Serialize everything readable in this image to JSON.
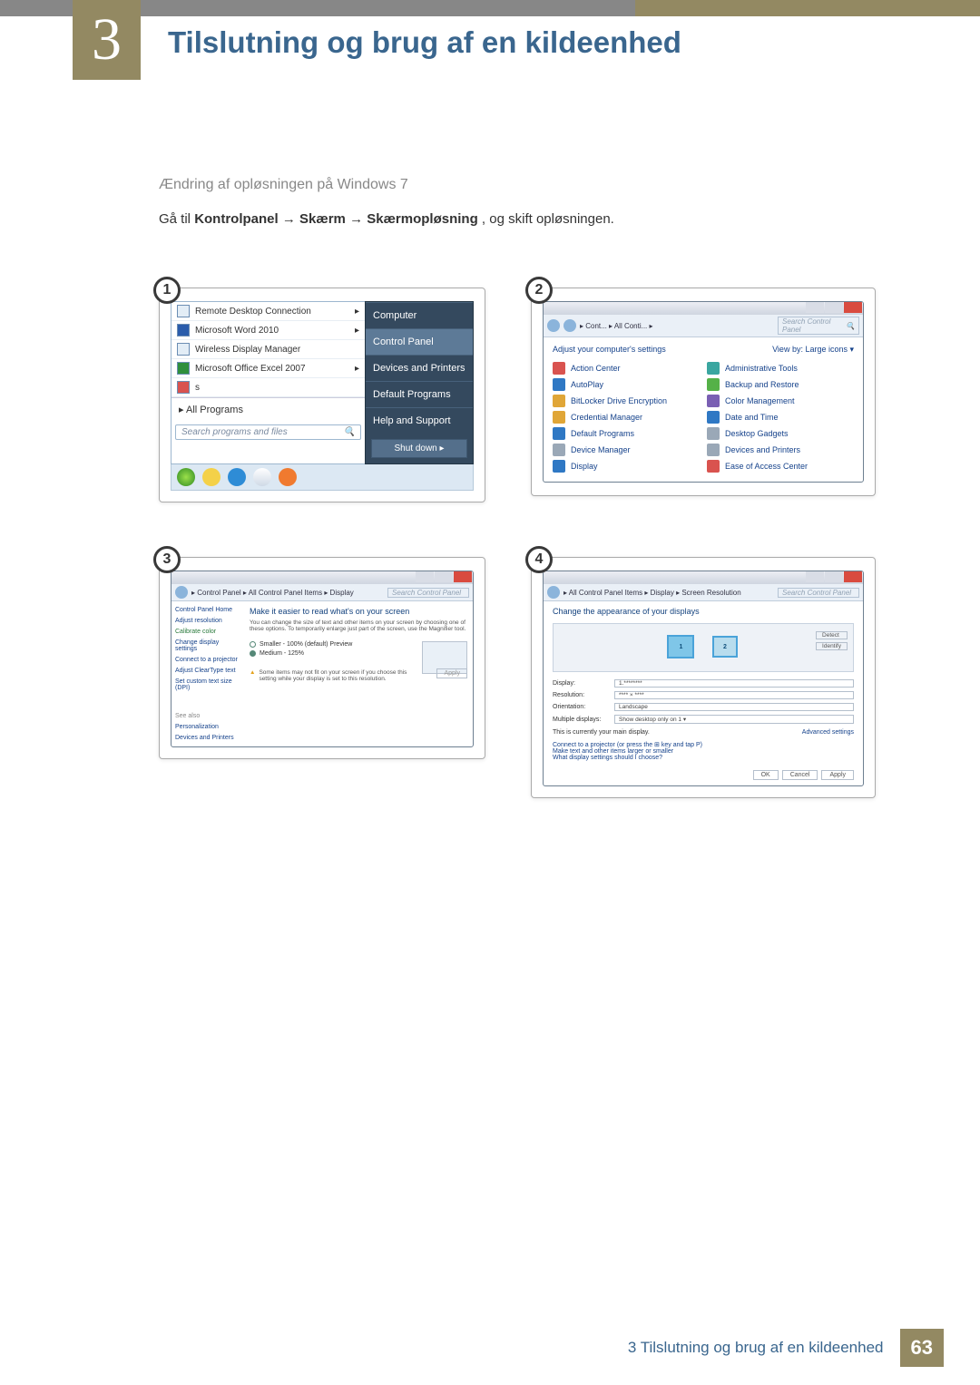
{
  "chapter": {
    "number": "3",
    "title": "Tilslutning og brug af en kildeenhed",
    "footer_label": "3 Tilslutning og brug af en kildeenhed",
    "page_number": "63"
  },
  "section": {
    "subtitle": "Ændring af opløsningen på Windows 7",
    "instruction_pre": "Gå til ",
    "path_1": "Kontrolpanel",
    "path_2": "Skærm",
    "path_3": "Skærmopløsning",
    "instruction_post": ", og skift opløsningen."
  },
  "steps": {
    "b1": "1",
    "b2": "2",
    "b3": "3",
    "b4": "4"
  },
  "step1": {
    "items": [
      "Remote Desktop Connection",
      "Microsoft Word 2010",
      "Wireless Display Manager",
      "Microsoft Office Excel 2007",
      "s"
    ],
    "all_programs": "All Programs",
    "search_placeholder": "Search programs and files",
    "right": {
      "computer": "Computer",
      "cpanel": "Control Panel",
      "devices": "Devices and Printers",
      "defprog": "Default Programs",
      "help": "Help and Support"
    },
    "shut": "Shut down ▸"
  },
  "step2": {
    "crumb": "▸ Cont... ▸ All Conti... ▸",
    "search": "Search Control Panel",
    "adjust": "Adjust your computer's settings",
    "view": "View by:  Large icons ▾",
    "items_left": [
      "Action Center",
      "AutoPlay",
      "BitLocker Drive Encryption",
      "Credential Manager",
      "Default Programs",
      "Device Manager",
      "Display"
    ],
    "items_right": [
      "Administrative Tools",
      "Backup and Restore",
      "Color Management",
      "Date and Time",
      "Desktop Gadgets",
      "Devices and Printers",
      "Ease of Access Center"
    ]
  },
  "step3": {
    "crumb": "▸ Control Panel ▸ All Control Panel Items ▸ Display",
    "search": "Search Control Panel",
    "side": [
      "Control Panel Home",
      "Adjust resolution",
      "Calibrate color",
      "Change display settings",
      "Connect to a projector",
      "Adjust ClearType text",
      "Set custom text size (DPI)"
    ],
    "side_also": "See also",
    "side_foot": [
      "Personalization",
      "Devices and Printers"
    ],
    "title": "Make it easier to read what's on your screen",
    "desc": "You can change the size of text and other items on your screen by choosing one of these options. To temporarily enlarge just part of the screen, use the Magnifier tool.",
    "r1": "Smaller - 100% (default)    Preview",
    "r2": "Medium - 125%",
    "warn": "Some items may not fit on your screen if you choose this setting while your display is set to this resolution.",
    "apply": "Apply"
  },
  "step4": {
    "crumb": "▸ All Control Panel Items ▸ Display ▸ Screen Resolution",
    "search": "Search Control Panel",
    "title": "Change the appearance of your displays",
    "detect": "Detect",
    "identify": "Identify",
    "k_display": "Display:",
    "v_display": "1.********",
    "k_res": "Resolution:",
    "v_res": "**** × ****",
    "k_ori": "Orientation:",
    "v_ori": "Landscape",
    "k_mult": "Multiple displays:",
    "v_mult": "Show desktop only on 1 ▾",
    "curr": "This is currently your main display.",
    "adv": "Advanced settings",
    "proj": "Connect to a projector (or press the ⊞ key and tap P)",
    "smaller": "Make text and other items larger or smaller",
    "what": "What display settings should I choose?",
    "ok": "OK",
    "cancel": "Cancel",
    "apply": "Apply"
  }
}
